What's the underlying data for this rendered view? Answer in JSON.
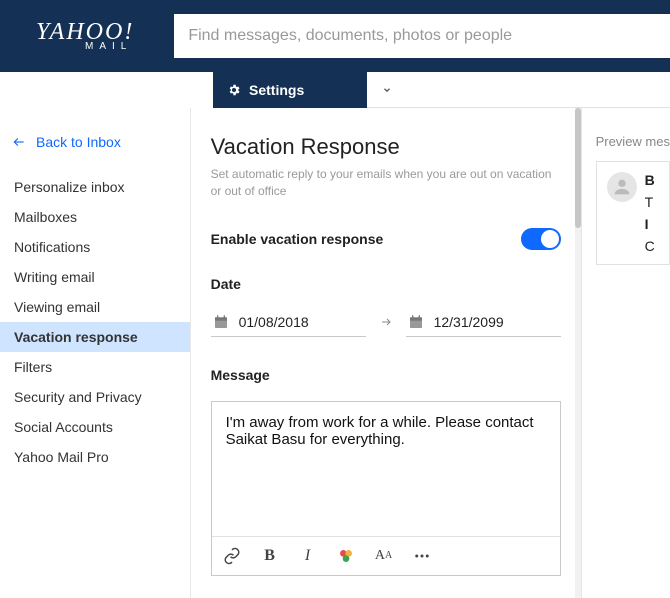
{
  "brand": {
    "name": "YAHOO",
    "sub": "MAIL"
  },
  "search": {
    "placeholder": "Find messages, documents, photos or people"
  },
  "subheader": {
    "settings": "Settings"
  },
  "sidebar": {
    "back": "Back to Inbox",
    "items": [
      {
        "label": "Personalize inbox"
      },
      {
        "label": "Mailboxes"
      },
      {
        "label": "Notifications"
      },
      {
        "label": "Writing email"
      },
      {
        "label": "Viewing email"
      },
      {
        "label": "Vacation response"
      },
      {
        "label": "Filters"
      },
      {
        "label": "Security and Privacy"
      },
      {
        "label": "Social Accounts"
      },
      {
        "label": "Yahoo Mail Pro"
      }
    ],
    "activeIndex": 5
  },
  "settings": {
    "title": "Vacation Response",
    "subtitle": "Set automatic reply to your emails when you are out on vacation or out of office",
    "enableLabel": "Enable vacation response",
    "enabled": true,
    "dateLabel": "Date",
    "startDate": "01/08/2018",
    "endDate": "12/31/2099",
    "messageLabel": "Message",
    "messageBody": "I'm away from work for a while. Please contact Saikat Basu for everything."
  },
  "preview": {
    "heading": "Preview mes",
    "lines": [
      "B",
      "T",
      "I",
      "C"
    ]
  }
}
